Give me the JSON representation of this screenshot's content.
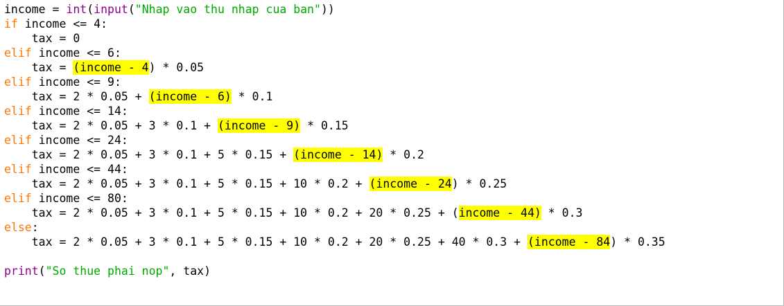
{
  "editor": {
    "lines": [
      {
        "tokens": [
          {
            "t": "income = "
          },
          {
            "t": "int",
            "c": "bi"
          },
          {
            "t": "("
          },
          {
            "t": "input",
            "c": "bi"
          },
          {
            "t": "("
          },
          {
            "t": "\"Nhap vao thu nhap cua ban\"",
            "c": "str"
          },
          {
            "t": "))"
          }
        ]
      },
      {
        "tokens": [
          {
            "t": "if",
            "c": "kw"
          },
          {
            "t": " income <= 4:"
          }
        ]
      },
      {
        "tokens": [
          {
            "t": "    tax = 0"
          }
        ]
      },
      {
        "tokens": [
          {
            "t": "elif",
            "c": "kw"
          },
          {
            "t": " income <= 6:"
          }
        ]
      },
      {
        "tokens": [
          {
            "t": "    tax = "
          },
          {
            "t": "(income - 4",
            "c": "hl"
          },
          {
            "t": ") * 0.05"
          }
        ]
      },
      {
        "tokens": [
          {
            "t": "elif",
            "c": "kw"
          },
          {
            "t": " income <= 9:"
          }
        ]
      },
      {
        "tokens": [
          {
            "t": "    tax = 2 * 0.05 + "
          },
          {
            "t": "(income - 6)",
            "c": "hl"
          },
          {
            "t": " * 0.1"
          }
        ]
      },
      {
        "tokens": [
          {
            "t": "elif",
            "c": "kw"
          },
          {
            "t": " income <= 14:"
          }
        ]
      },
      {
        "tokens": [
          {
            "t": "    tax = 2 * 0.05 + 3 * 0.1 + "
          },
          {
            "t": "(income - 9)",
            "c": "hl"
          },
          {
            "t": " * 0.15"
          }
        ]
      },
      {
        "tokens": [
          {
            "t": "elif",
            "c": "kw"
          },
          {
            "t": " income <= 24:"
          }
        ]
      },
      {
        "tokens": [
          {
            "t": "    tax = 2 * 0.05 + 3 * 0.1 + 5 * 0.15 + "
          },
          {
            "t": "(income - 14)",
            "c": "hl"
          },
          {
            "t": " * 0.2"
          }
        ]
      },
      {
        "tokens": [
          {
            "t": "elif",
            "c": "kw"
          },
          {
            "t": " income <= 44:"
          }
        ]
      },
      {
        "tokens": [
          {
            "t": "    tax = 2 * 0.05 + 3 * 0.1 + 5 * 0.15 + 10 * 0.2 + "
          },
          {
            "t": "(income - 24",
            "c": "hl"
          },
          {
            "t": ") * 0.25"
          }
        ]
      },
      {
        "tokens": [
          {
            "t": "elif",
            "c": "kw"
          },
          {
            "t": " income <= 80:"
          }
        ]
      },
      {
        "tokens": [
          {
            "t": "    tax = 2 * 0.05 + 3 * 0.1 + 5 * 0.15 + 10 * 0.2 + 20 * 0.25 + ("
          },
          {
            "t": "income - 44)",
            "c": "hl"
          },
          {
            "t": " * 0.3"
          }
        ]
      },
      {
        "tokens": [
          {
            "t": "else",
            "c": "kw"
          },
          {
            "t": ":"
          }
        ]
      },
      {
        "tokens": [
          {
            "t": "    tax = 2 * 0.05 + 3 * 0.1 + 5 * 0.15 + 10 * 0.2 + 20 * 0.25 + 40 * 0.3 + "
          },
          {
            "t": "(income - 84",
            "c": "hl"
          },
          {
            "t": ") * 0.35"
          }
        ]
      },
      {
        "tokens": [
          {
            "t": ""
          }
        ]
      },
      {
        "tokens": [
          {
            "t": "print",
            "c": "bi"
          },
          {
            "t": "("
          },
          {
            "t": "\"So thue phai nop\"",
            "c": "str"
          },
          {
            "t": ", tax)"
          }
        ]
      }
    ]
  },
  "colors": {
    "keyword": "#ff7700",
    "builtin": "#900090",
    "string": "#00aa00",
    "highlight": "#ffff00",
    "text": "#000000",
    "background": "#ffffff"
  }
}
